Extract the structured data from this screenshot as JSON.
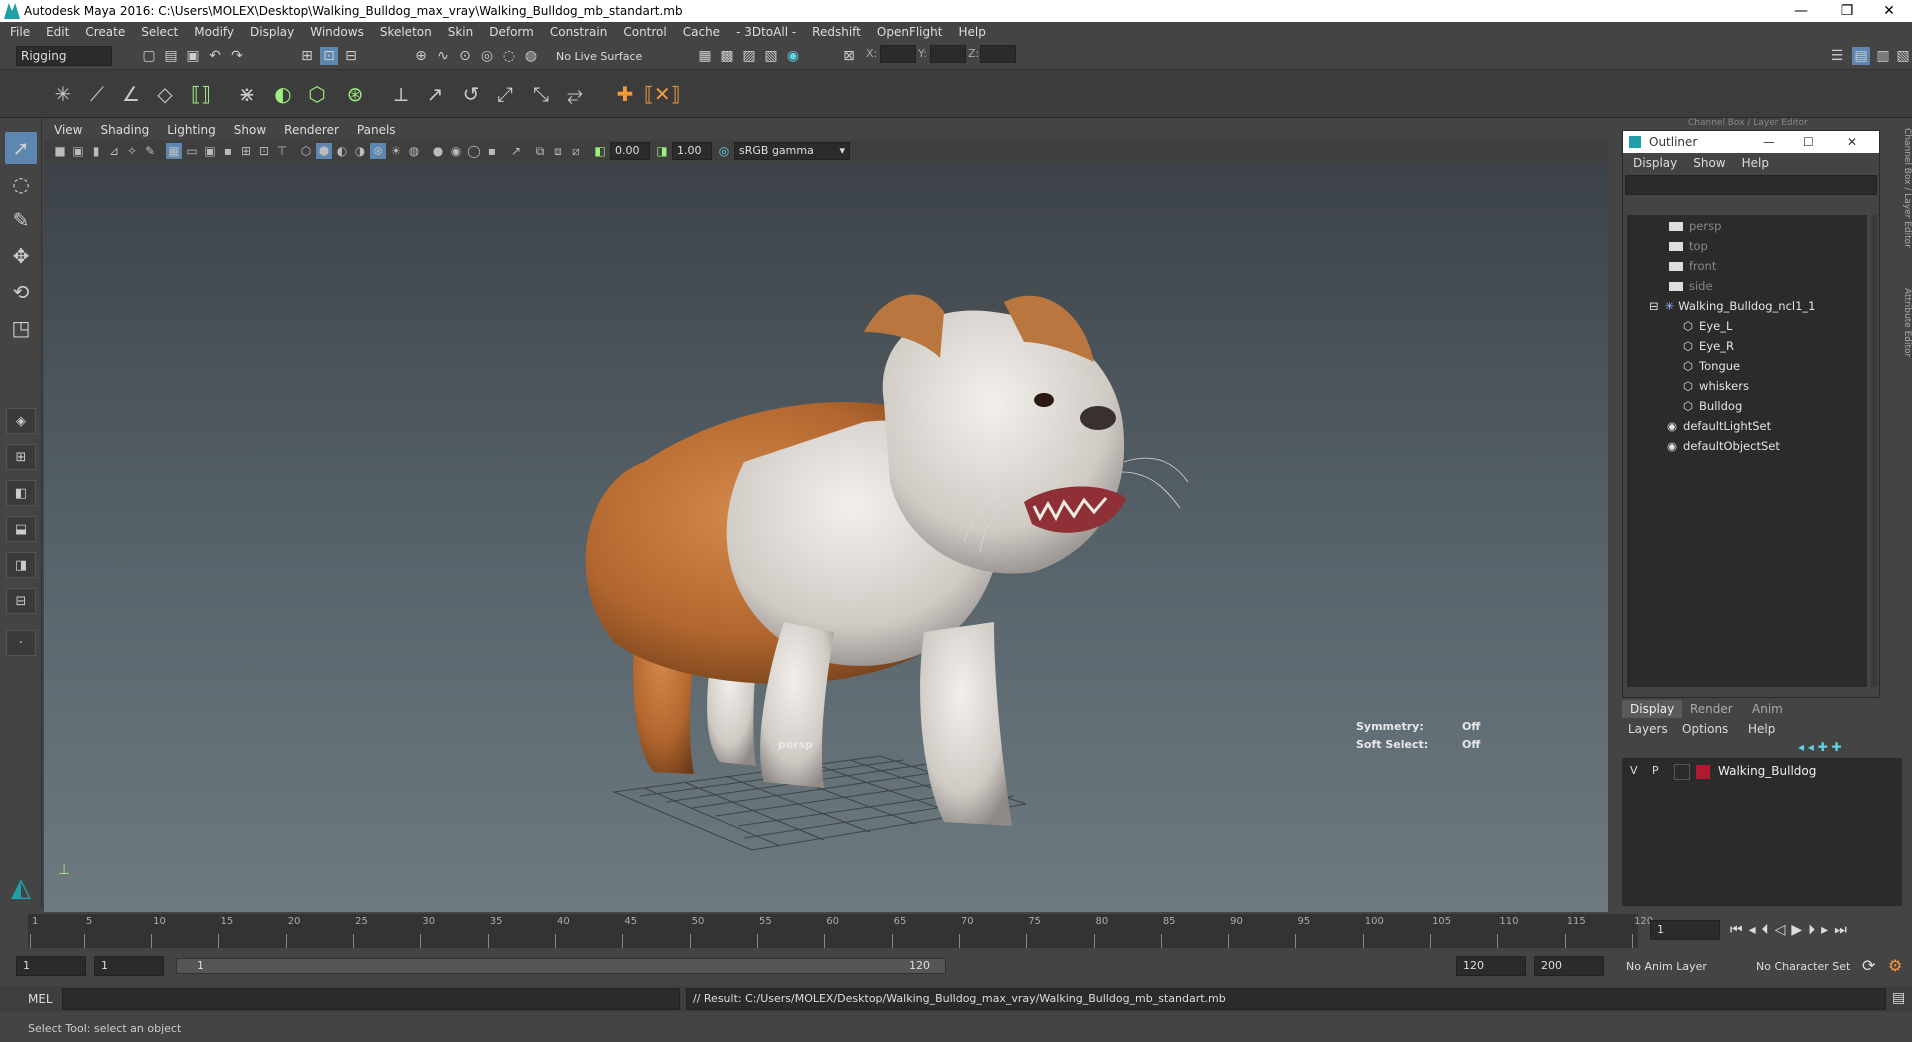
{
  "window": {
    "title": "Autodesk Maya 2016: C:\\Users\\MOLEX\\Desktop\\Walking_Bulldog_max_vray\\Walking_Bulldog_mb_standart.mb",
    "minimize": "—",
    "restore": "❐",
    "close": "✕"
  },
  "menubar": [
    "File",
    "Edit",
    "Create",
    "Select",
    "Modify",
    "Display",
    "Windows",
    "Skeleton",
    "Skin",
    "Deform",
    "Constrain",
    "Control",
    "Cache",
    "- 3DtoAll -",
    "Redshift",
    "OpenFlight",
    "Help"
  ],
  "statusline": {
    "menuset": "Rigging",
    "live_surface": "No Live Surface",
    "x_label": "X:",
    "y_label": "Y:",
    "z_label": "Z:"
  },
  "viewport": {
    "menu": [
      "View",
      "Shading",
      "Lighting",
      "Show",
      "Renderer",
      "Panels"
    ],
    "exposure": "0.00",
    "gamma": "1.00",
    "color_space": "sRGB gamma",
    "camera_label": "persp",
    "symmetry_label": "Symmetry:",
    "symmetry_value": "Off",
    "soft_select_label": "Soft Select:",
    "soft_select_value": "Off"
  },
  "right_panel": {
    "tab_title": "Channel Box / Layer Editor",
    "side_tab_1": "Channel Box / Layer Editor",
    "side_tab_2": "Attribute Editor"
  },
  "outliner": {
    "title": "Outliner",
    "menu": [
      "Display",
      "Show",
      "Help"
    ],
    "cameras": [
      "persp",
      "top",
      "front",
      "side"
    ],
    "group": "Walking_Bulldog_ncl1_1",
    "children": [
      "Eye_L",
      "Eye_R",
      "Tongue",
      "whiskers",
      "Bulldog"
    ],
    "sets": [
      "defaultLightSet",
      "defaultObjectSet"
    ]
  },
  "layer_editor": {
    "tabs": [
      "Display",
      "Render",
      "Anim"
    ],
    "menu": [
      "Layers",
      "Options",
      "Help"
    ],
    "layer": {
      "visible": "V",
      "playback": "P",
      "name": "Walking_Bulldog",
      "color": "#b0192f"
    }
  },
  "timeline": {
    "ticks": [
      "1",
      "5",
      "10",
      "15",
      "20",
      "25",
      "30",
      "35",
      "40",
      "45",
      "50",
      "55",
      "60",
      "65",
      "70",
      "75",
      "80",
      "85",
      "90",
      "95",
      "100",
      "105",
      "110",
      "115",
      "120"
    ],
    "current_frame": "1"
  },
  "range": {
    "start": "1",
    "playback_start": "1",
    "slider_start": "1",
    "slider_end": "120",
    "playback_end": "120",
    "end": "200",
    "anim_layer": "No Anim Layer",
    "character_set": "No Character Set"
  },
  "command": {
    "lang": "MEL",
    "result": "// Result: C:/Users/MOLEX/Desktop/Walking_Bulldog_max_vray/Walking_Bulldog_mb_standart.mb"
  },
  "help_line": "Select Tool: select an object",
  "icons": [
    "maya-logo-icon",
    "select-tool-icon",
    "lasso-tool-icon",
    "paint-tool-icon",
    "move-tool-icon",
    "rotate-tool-icon",
    "scale-tool-icon",
    "camera-icon",
    "play-icon"
  ]
}
